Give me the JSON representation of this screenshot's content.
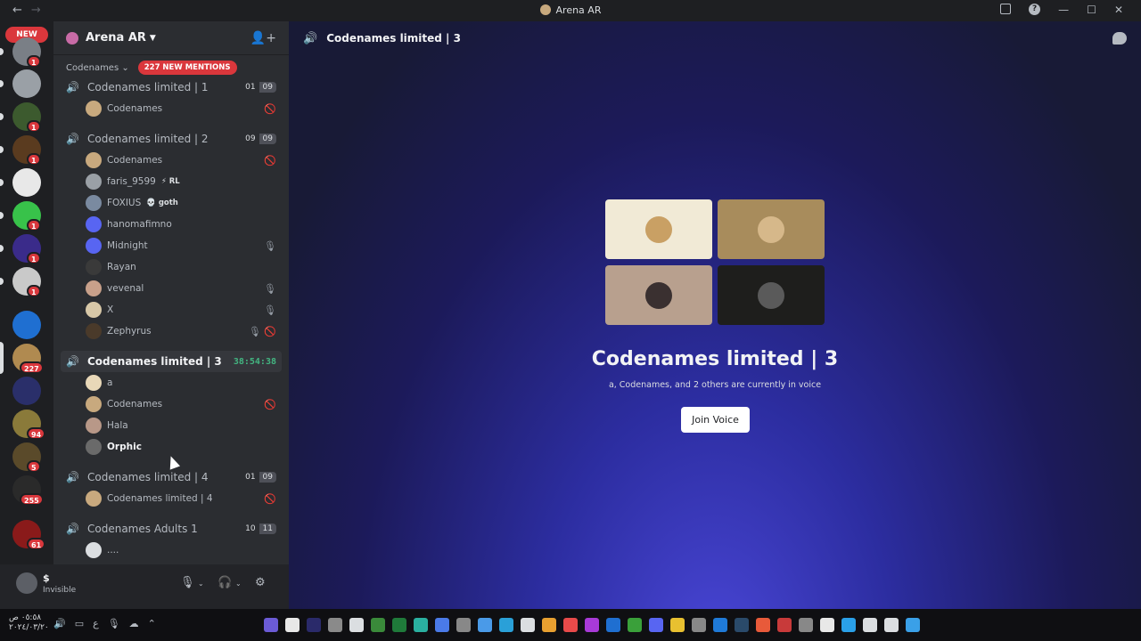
{
  "window": {
    "title": "Arena AR"
  },
  "rail": {
    "new_label": "NEW",
    "servers": [
      {
        "badge": "1",
        "color": "#7a7f86"
      },
      {
        "badge": "",
        "color": "#9aa0a6"
      },
      {
        "badge": "1",
        "color": "#3c5a2e"
      },
      {
        "badge": "1",
        "color": "#5a3b1f"
      },
      {
        "badge": "",
        "color": "#e8e8e8"
      },
      {
        "badge": "1",
        "color": "#38c24a"
      },
      {
        "badge": "1",
        "color": "#3a2b8a"
      },
      {
        "badge": "1",
        "color": "#c9c9c9"
      },
      {
        "badge": "",
        "color": "#1f6fd1"
      },
      {
        "badge": "227",
        "color": "#b08a50"
      },
      {
        "badge": "",
        "color": "#2a2f6a"
      },
      {
        "badge": "94",
        "color": "#8a7a3a"
      },
      {
        "badge": "5",
        "color": "#5a4a2a"
      },
      {
        "badge": "255",
        "color": "#2a2a2a"
      },
      {
        "badge": "61",
        "color": "#8a1a1a"
      }
    ]
  },
  "guild": {
    "name": "Arena AR"
  },
  "category": {
    "name": "Codenames",
    "mentions": "227 NEW MENTIONS"
  },
  "channels": [
    {
      "name": "Codenames limited | 1",
      "count_a": "01",
      "count_b": "09",
      "users": [
        {
          "name": "Codenames",
          "icon": "🚫",
          "color": "#c8a97e"
        }
      ]
    },
    {
      "name": "Codenames limited | 2",
      "count_a": "09",
      "count_b": "09",
      "users": [
        {
          "name": "Codenames",
          "icon": "🚫",
          "color": "#c8a97e"
        },
        {
          "name": "faris_9599",
          "tag": "⚡ RL",
          "icon": "",
          "color": "#9aa0a6"
        },
        {
          "name": "FOXIUS",
          "tag": "💀 goth",
          "icon": "",
          "color": "#7a8aa0"
        },
        {
          "name": "hanomafimno",
          "icon": "",
          "color": "#5865f2"
        },
        {
          "name": "Midnight",
          "icon": "🎙",
          "color": "#5865f2"
        },
        {
          "name": "Rayan",
          "icon": "",
          "color": "#3a3a3a"
        },
        {
          "name": "vevenal",
          "icon": "🎙",
          "color": "#c8a08a"
        },
        {
          "name": "X",
          "icon": "🎙",
          "color": "#d8c8a8"
        },
        {
          "name": "Zephyrus",
          "icon": "🎙 🚫",
          "color": "#4a3a2a"
        }
      ]
    },
    {
      "name": "Codenames limited | 3",
      "timer": "38:54:38",
      "users": [
        {
          "name": "a",
          "icon": "",
          "color": "#e8d8b8"
        },
        {
          "name": "Codenames",
          "icon": "🚫",
          "color": "#c8a97e"
        },
        {
          "name": "Hala",
          "icon": "",
          "color": "#b89888"
        },
        {
          "name": "Orphic",
          "icon": "",
          "color": "#6a6a6a"
        }
      ]
    },
    {
      "name": "Codenames limited | 4",
      "count_a": "01",
      "count_b": "09",
      "users": [
        {
          "name": "Codenames limited | 4",
          "icon": "🚫",
          "color": "#c8a97e"
        }
      ]
    },
    {
      "name": "Codenames Adults 1",
      "count_a": "10",
      "count_b": "11",
      "users": [
        {
          "name": "....",
          "icon": "",
          "color": "#dbdee1"
        }
      ]
    }
  ],
  "user_panel": {
    "name": "$",
    "status": "Invisible"
  },
  "main": {
    "channel_title": "Codenames limited | 3",
    "voice_title": "Codenames limited | 3",
    "voice_subtitle": "a, Codenames, and 2 others are currently in voice",
    "join_label": "Join Voice",
    "tiles": [
      {
        "bg": "#f1ead6",
        "face": "#c9a064"
      },
      {
        "bg": "#a88c5c",
        "face": "#d6b88a"
      },
      {
        "bg": "#b8a08e",
        "face": "#3a3030"
      },
      {
        "bg": "#1e1e1c",
        "face": "#5a5a5a"
      }
    ]
  },
  "taskbar": {
    "time": "٠٥:٥٨ ص",
    "date": "٢٠٢٤/٠٣/٢٠"
  }
}
